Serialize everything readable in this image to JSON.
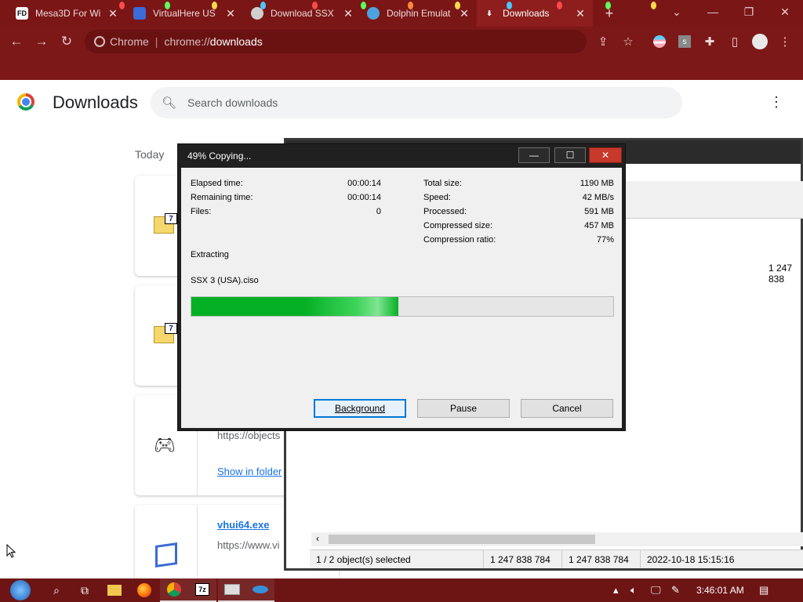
{
  "browser": {
    "tabs": [
      {
        "label": "Mesa3D For Wi",
        "fav": "FD",
        "fav_bg": "#f5f5f5",
        "fav_fg": "#111"
      },
      {
        "label": "VirtualHere US",
        "fav": "",
        "fav_bg": "#3b6bd6",
        "fav_fg": "#fff"
      },
      {
        "label": "Download SSX",
        "fav": "",
        "fav_bg": "#cfcfcf",
        "fav_fg": "#fff"
      },
      {
        "label": "Dolphin Emulat",
        "fav": "",
        "fav_bg": "#4da3e0",
        "fav_fg": "#fff"
      },
      {
        "label": "Downloads",
        "fav": "⬇",
        "fav_bg": "transparent",
        "fav_fg": "#fff"
      }
    ],
    "new_tab": "+",
    "omnibox": {
      "site": "Chrome",
      "url_prefix": "chrome://",
      "url_path": "downloads"
    }
  },
  "downloads": {
    "title": "Downloads",
    "search_placeholder": "Search downloads",
    "section": "Today",
    "items": [
      {
        "icon": "7z-folder-icon"
      },
      {
        "icon": "7z-folder-icon"
      },
      {
        "icon": "gamepad-icon",
        "url": "https://objects",
        "action": "Show in folder"
      },
      {
        "icon": "app-icon",
        "file": "vhui64.exe",
        "url": "https://www.vi",
        "action": "Show in folder"
      }
    ]
  },
  "file_manager": {
    "size_value": "1 247 838",
    "status": [
      "1 / 2 object(s) selected",
      "1 247 838 784",
      "1 247 838 784",
      "2022-10-18 15:15:16"
    ]
  },
  "dialog": {
    "title": "49% Copying...",
    "progress_fraction": 0.49,
    "left_stats": [
      {
        "label": "Elapsed time:",
        "value": "00:00:14"
      },
      {
        "label": "Remaining time:",
        "value": "00:00:14"
      },
      {
        "label": "Files:",
        "value": "0"
      }
    ],
    "right_stats": [
      {
        "label": "Total size:",
        "value": "1190 MB"
      },
      {
        "label": "Speed:",
        "value": "42 MB/s"
      },
      {
        "label": "Processed:",
        "value": "591 MB"
      },
      {
        "label": "Compressed size:",
        "value": "457 MB"
      },
      {
        "label": "Compression ratio:",
        "value": "77%"
      }
    ],
    "operation": "Extracting",
    "current_file": "SSX 3 (USA).ciso",
    "buttons": {
      "background": "Background",
      "pause": "Pause",
      "cancel": "Cancel"
    }
  },
  "taskbar": {
    "clock": "3:46:01 AM"
  }
}
